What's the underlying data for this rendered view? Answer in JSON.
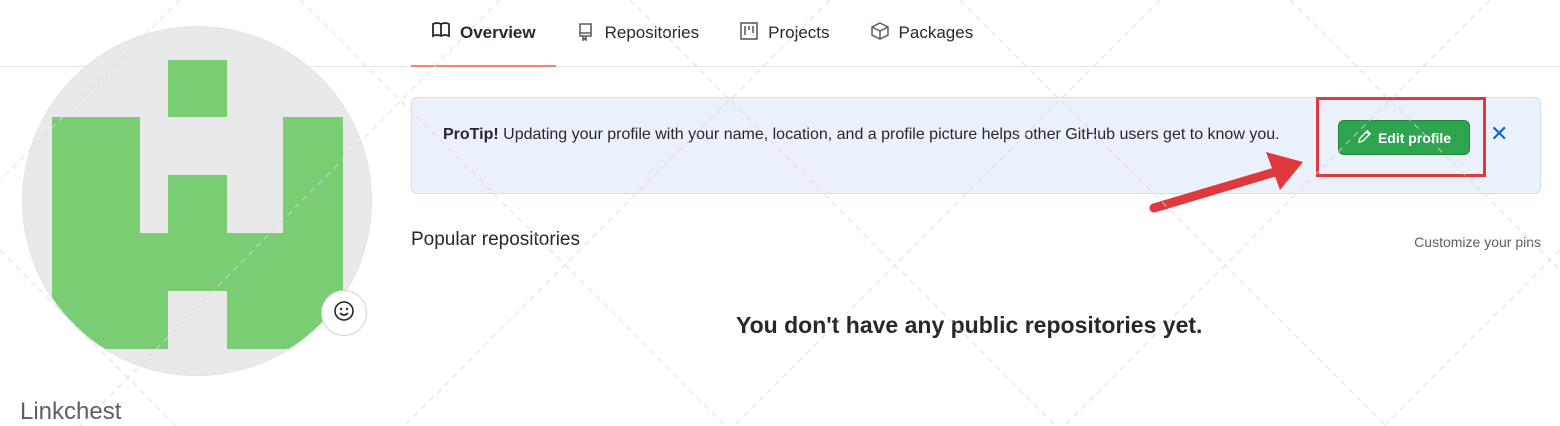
{
  "tabs": [
    {
      "label": "Overview",
      "icon": "book-icon",
      "active": true
    },
    {
      "label": "Repositories",
      "icon": "repo-icon",
      "active": false
    },
    {
      "label": "Projects",
      "icon": "project-icon",
      "active": false
    },
    {
      "label": "Packages",
      "icon": "package-icon",
      "active": false
    }
  ],
  "profile": {
    "username": "Linkchest"
  },
  "protip": {
    "bold": "ProTip!",
    "text": " Updating your profile with your name, location, and a profile picture helps other GitHub users get to know you.",
    "edit_label": "Edit profile",
    "close_symbol": "✕"
  },
  "repos": {
    "title": "Popular repositories",
    "customize_label": "Customize your pins",
    "empty_message": "You don't have any public repositories yet."
  },
  "colors": {
    "accent_underline": "#f9826c",
    "button_green": "#2ea44f",
    "annotation_red": "#e0393d",
    "avatar_green": "#7acd72"
  }
}
